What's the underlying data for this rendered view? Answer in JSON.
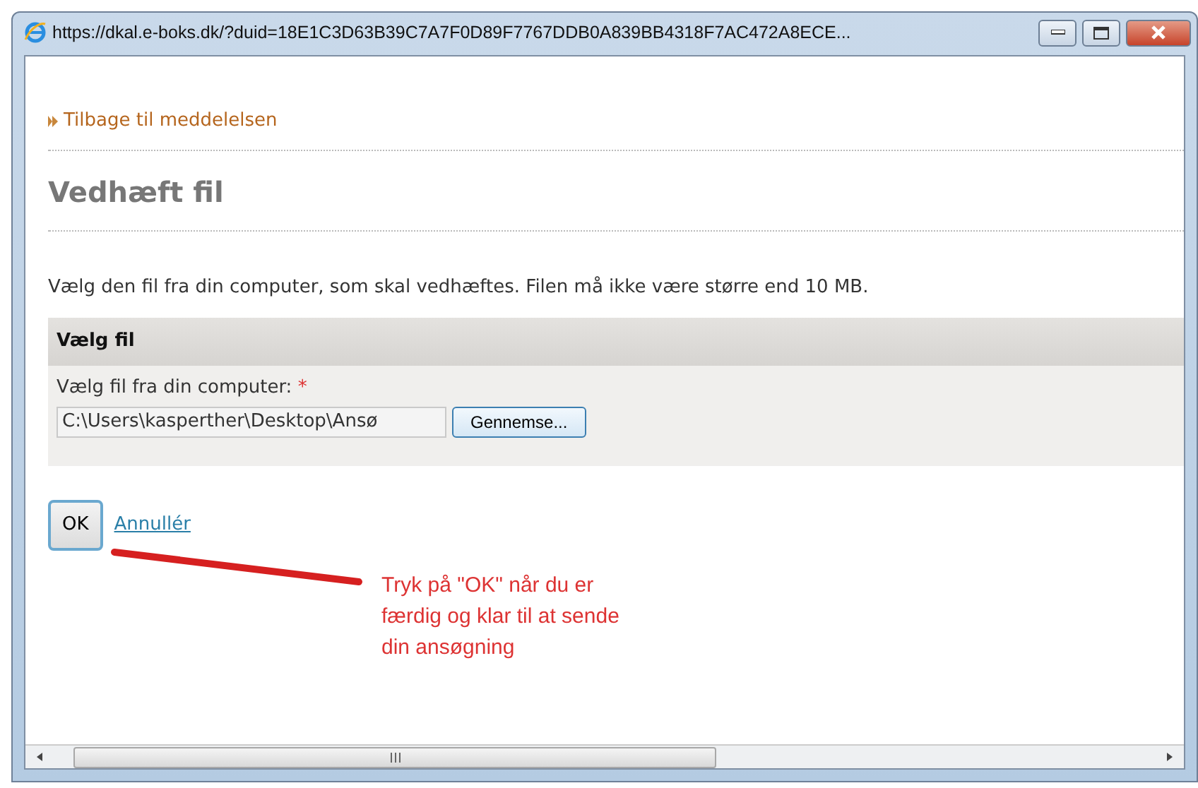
{
  "window": {
    "title": "https://dkal.e-boks.dk/?duid=18E1C3D63B39C7A7F0D89F7767DDB0A839BB4318F7AC472A8ECE..."
  },
  "back_link": "Tilbage til meddelelsen",
  "heading": "Vedhæft fil",
  "instruction": "Vælg den fil fra din computer, som skal vedhæftes. Filen må ikke være større end 10 MB.",
  "panel": {
    "title": "Vælg fil",
    "field_label": "Vælg fil fra din computer:",
    "required_mark": "*",
    "file_value": "C:\\Users\\kasperther\\Desktop\\Ansø",
    "browse_button": "Gennemse..."
  },
  "ok_button": "OK",
  "cancel_link": "Annullér",
  "annotation": "Tryk på \"OK\" når du er færdig og klar til at sende din ansøgning"
}
